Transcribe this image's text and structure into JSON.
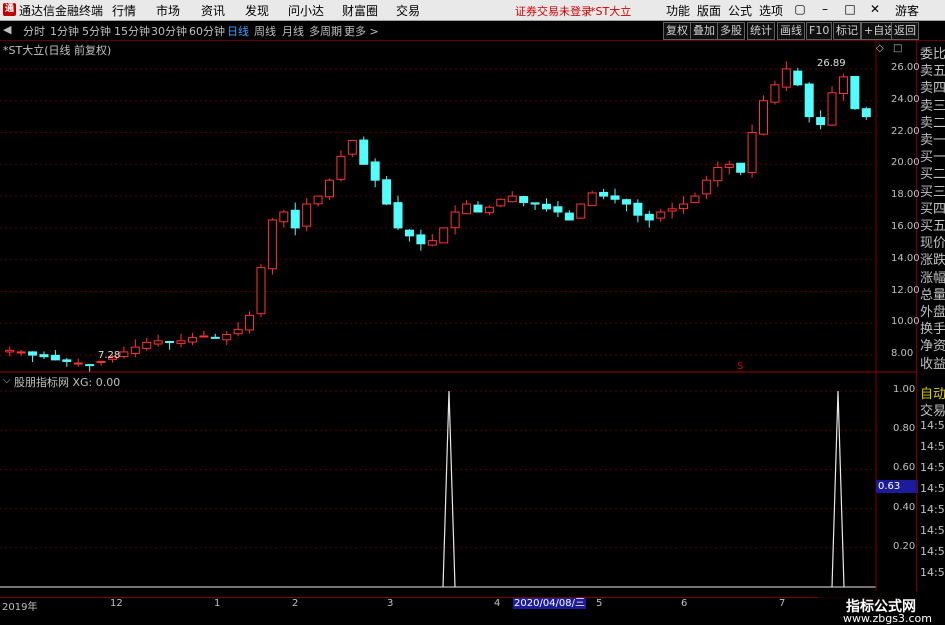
{
  "app": {
    "name": "通达信金融终端"
  },
  "menu": {
    "items": [
      "行情",
      "市场",
      "资讯",
      "发现",
      "问小达",
      "财富圈",
      "交易"
    ],
    "status": "证券交易未登录",
    "stock": "*ST大立",
    "right": [
      "功能",
      "版面",
      "公式",
      "选项"
    ],
    "user": "游客"
  },
  "toolbar": {
    "periods": [
      "分时",
      "1分钟",
      "5分钟",
      "15分钟",
      "30分钟",
      "60分钟",
      "日线",
      "周线",
      "月线",
      "多周期",
      "更多 >"
    ],
    "active_index": 6,
    "buttons": [
      "复权",
      "叠加",
      "多股",
      "统计",
      "画线",
      "F10",
      "标记",
      "+自选",
      "返回"
    ]
  },
  "main_chart": {
    "title": "*ST大立(日线 前复权)",
    "high_label": "26.89",
    "low_label": "7.28"
  },
  "sub_chart": {
    "title": "股朋指标网 XG: 0.00",
    "cursor_value": "0.63"
  },
  "right_panel": {
    "labels": [
      "委比",
      "卖五",
      "卖四",
      "卖三",
      "卖二",
      "卖一",
      "买一",
      "买二",
      "买三",
      "买四",
      "买五",
      "现价",
      "涨跌",
      "涨幅",
      "总量",
      "外盘",
      "换手",
      "净资",
      "收益"
    ],
    "sub_labels": [
      "自动",
      "交易"
    ],
    "times": [
      "14:55",
      "14:56",
      "14:56",
      "14:56",
      "14:56",
      "14:56",
      "14:56",
      "14:56"
    ]
  },
  "date_axis": {
    "labels": [
      "2019年",
      "12",
      "1",
      "2",
      "3",
      "4",
      "5",
      "6",
      "7"
    ],
    "cursor_date": "2020/04/08/三"
  },
  "watermark": {
    "title": "指标公式网",
    "url": "www.zbgs3.com"
  },
  "chart_data": [
    {
      "type": "candlestick",
      "title": "*ST大立(日线 前复权)",
      "y_ticks": [
        "8.00",
        "10.00",
        "12.00",
        "14.00",
        "16.00",
        "18.00",
        "20.00",
        "22.00",
        "24.00",
        "26.00"
      ],
      "ylim": [
        7.0,
        27.0
      ],
      "high": 26.89,
      "low": 7.28,
      "approx_close_series": [
        8.3,
        8.2,
        8.0,
        7.9,
        7.7,
        7.6,
        7.5,
        7.4,
        7.6,
        7.9,
        8.2,
        8.5,
        8.8,
        8.9,
        8.8,
        8.9,
        9.1,
        9.2,
        9.1,
        9.3,
        9.6,
        10.5,
        13.5,
        16.5,
        17.0,
        16.0,
        17.5,
        18.0,
        19.0,
        20.5,
        21.5,
        20.0,
        19.0,
        17.5,
        16.0,
        15.5,
        15.0,
        15.2,
        16.0,
        17.0,
        17.5,
        17.0,
        17.3,
        17.8,
        18.0,
        17.6,
        17.5,
        17.2,
        17.0,
        16.5,
        17.5,
        18.2,
        18.0,
        17.8,
        17.5,
        16.8,
        16.5,
        17.0,
        17.2,
        17.5,
        18.0,
        19.0,
        19.8,
        20.0,
        19.5,
        22.0,
        24.0,
        25.0,
        26.0,
        25.0,
        23.0,
        22.5,
        24.5,
        25.5,
        23.5,
        23.0
      ]
    },
    {
      "type": "line",
      "title": "股朋指标网 XG: 0.00",
      "y_ticks": [
        "0.20",
        "0.40",
        "0.60",
        "0.80",
        "1.00"
      ],
      "ylim": [
        0,
        1.0
      ],
      "spike_dates": [
        "2020/04/08"
      ],
      "values_desc": "0 except spikes to 1.00"
    }
  ]
}
